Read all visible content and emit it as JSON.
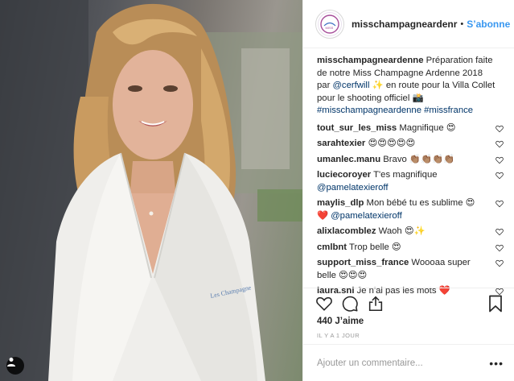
{
  "header": {
    "username": "misschampagneardenr",
    "separator": "•",
    "follow_label": "S’abonne"
  },
  "caption": {
    "username": "misschampagneardenne",
    "text_1": "Préparation faite de notre Miss Champagne Ardenne 2018 par",
    "mention": "@cerfwill",
    "text_2": "✨ en route pour la Villa Collet pour le shooting officiel 📸",
    "hashtags": "#misschampagneardenne #missfrance"
  },
  "comments": [
    {
      "username": "tout_sur_les_miss",
      "text": "Magnifique 😍"
    },
    {
      "username": "sarahtexier",
      "text": "😍😍😍😍😍"
    },
    {
      "username": "umanlec.manu",
      "text": "Bravo 👏🏽👏🏽👏🏽👏🏽"
    },
    {
      "username": "luciecoroyer",
      "text": "T'es magnifique",
      "mention": "@pamelatexieroff"
    },
    {
      "username": "maylis_dlp",
      "text": "Mon bébé tu es sublime 😍 ❤️",
      "mention": "@pamelatexieroff"
    },
    {
      "username": "alixlacomblez",
      "text": "Waoh 😍✨"
    },
    {
      "username": "cmlbnt",
      "text": "Trop belle 😍"
    },
    {
      "username": "support_miss_france",
      "text": "Woooaa super belle 😍😍😍"
    },
    {
      "username": "laura.snl",
      "text": "Je n'ai pas les mots ❤️"
    }
  ],
  "actions": {
    "icons": [
      "heart-icon",
      "comment-icon",
      "share-icon",
      "bookmark-icon"
    ],
    "likes": "440 J’aime",
    "timestamp": "IL Y A 1 JOUR"
  },
  "comment_box": {
    "placeholder": "Ajouter un commentaire...",
    "more": "•••"
  },
  "colors": {
    "link": "#3897f0",
    "mention": "#003569",
    "muted": "#999999",
    "border": "#efefef"
  }
}
